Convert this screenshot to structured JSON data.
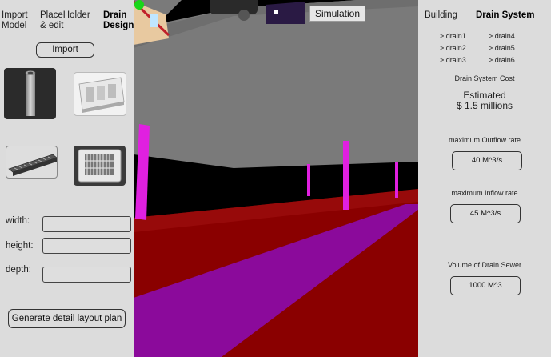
{
  "left": {
    "tabs": [
      {
        "label_1": "Import",
        "label_2": "Model"
      },
      {
        "label_1": "PlaceHolder",
        "label_2": "& edit"
      },
      {
        "label_1": "Drain",
        "label_2": "Design"
      }
    ],
    "import_button": "Import",
    "fields": [
      {
        "label": "width:",
        "value": ""
      },
      {
        "label": "height:",
        "value": ""
      },
      {
        "label": "depth:",
        "value": ""
      }
    ],
    "generate_button": "Generate detail layout plan"
  },
  "viewport": {
    "simulation_button": "Simulation"
  },
  "right": {
    "tabs": [
      "Building",
      "Drain System"
    ],
    "drains": [
      "> drain1",
      "> drain4",
      "> drain2",
      "> drain5",
      "> drain3",
      "> drain6"
    ],
    "cost_title": "Drain System Cost",
    "estimated_label": "Estimated",
    "estimated_value": "$ 1.5 millions",
    "outflow_label": "maximum Outflow rate",
    "outflow_value": "40 M^3/s",
    "inflow_label": "maximum Inflow rate",
    "inflow_value": "45 M^3/s",
    "volume_label": "Volume of Drain Sewer",
    "volume_value": "1000 M^3"
  },
  "colors": {
    "panel": "#dcdcdc",
    "viewport_bg": "#000000",
    "pipe_magenta": "#e020e0",
    "floor_red": "#8a0000",
    "channel_purple": "#8b0a9b",
    "ceiling_grey": "#7a7a7a"
  }
}
